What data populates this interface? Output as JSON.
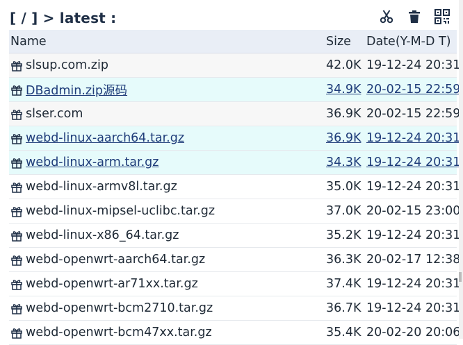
{
  "header": {
    "path": "[ / ] > latest :"
  },
  "toolbar": {
    "cut_icon": "scissors-icon",
    "delete_icon": "trash-icon",
    "qr_icon": "qrcode-icon"
  },
  "table": {
    "headers": {
      "name": "Name",
      "size": "Size",
      "date": "Date(Y-M-D T)"
    },
    "rows": [
      {
        "name": "slsup.com.zip",
        "size": "42.0K",
        "date": "19-12-24 20:31",
        "style": "alt"
      },
      {
        "name": "DBadmin.zip源码",
        "size": "34.9K",
        "date": "20-02-15 22:59",
        "style": "hl"
      },
      {
        "name": "slser.com",
        "size": "36.9K",
        "date": "20-02-15 22:59",
        "style": "alt"
      },
      {
        "name": "webd-linux-aarch64.tar.gz",
        "size": "36.9K",
        "date": "19-12-24 20:31",
        "style": "hl"
      },
      {
        "name": "webd-linux-arm.tar.gz",
        "size": "34.3K",
        "date": "19-12-24 20:31",
        "style": "hl"
      },
      {
        "name": "webd-linux-armv8l.tar.gz",
        "size": "35.0K",
        "date": "19-12-24 20:31",
        "style": ""
      },
      {
        "name": "webd-linux-mipsel-uclibc.tar.gz",
        "size": "37.0K",
        "date": "20-02-15 23:00",
        "style": ""
      },
      {
        "name": "webd-linux-x86_64.tar.gz",
        "size": "35.2K",
        "date": "19-12-24 20:31",
        "style": ""
      },
      {
        "name": "webd-openwrt-aarch64.tar.gz",
        "size": "36.3K",
        "date": "20-02-17 12:38",
        "style": ""
      },
      {
        "name": "webd-openwrt-ar71xx.tar.gz",
        "size": "37.4K",
        "date": "19-12-24 20:31",
        "style": ""
      },
      {
        "name": "webd-openwrt-bcm2710.tar.gz",
        "size": "36.7K",
        "date": "19-12-24 20:31",
        "style": ""
      },
      {
        "name": "webd-openwrt-bcm47xx.tar.gz",
        "size": "35.4K",
        "date": "20-02-20 20:06",
        "style": ""
      }
    ]
  },
  "colors": {
    "header_bg": "#e9eef6",
    "highlight_bg": "#e6fbfb",
    "alt_bg": "#f7f7f7",
    "link": "#1f3d7a",
    "icon": "#1f2f46"
  },
  "row_icon": "gift-icon"
}
